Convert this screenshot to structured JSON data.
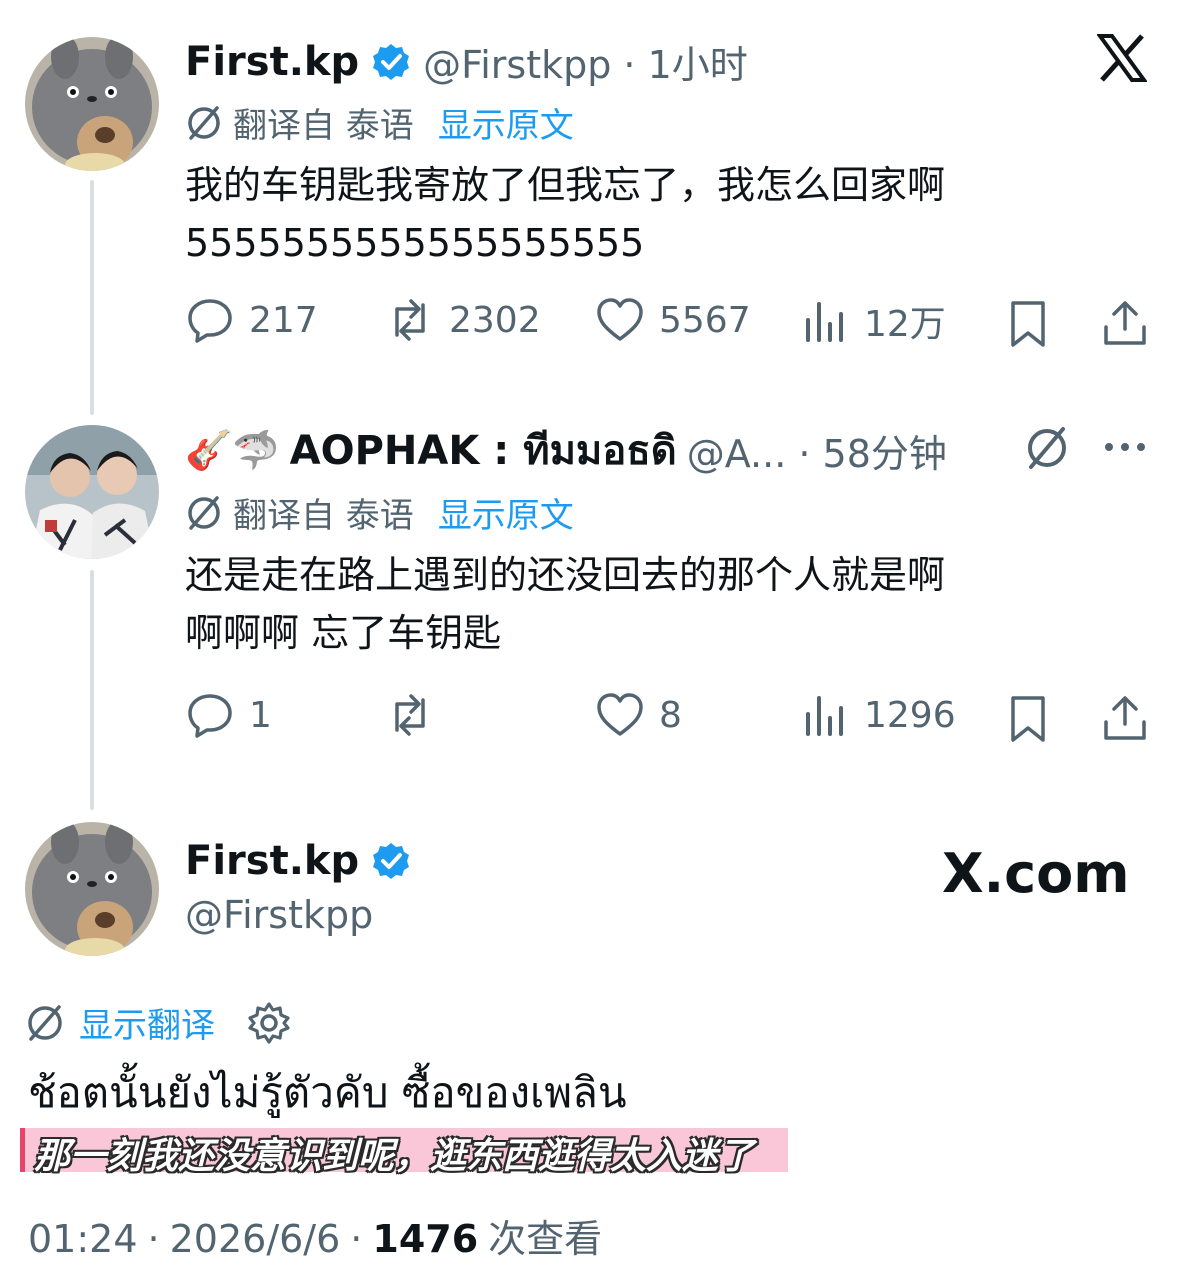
{
  "tweet1": {
    "name": "First.kp",
    "handle_time": "@Firstkpp · 1小时",
    "translated_from": "翻译自 泰语",
    "show_original": "显示原文",
    "text_line1": "我的车钥匙我寄放了但我忘了，我怎么回家啊",
    "text_line2": "5555555555555555555",
    "replies": "217",
    "retweets": "2302",
    "likes": "5567",
    "views": "12万"
  },
  "tweet2": {
    "emoji": "🎸🦈",
    "name": "AOPHAK : ทีมมอธดิ",
    "handle_time": "@A... · 58分钟",
    "translated_from": "翻译自 泰语",
    "show_original": "显示原文",
    "text_line1": "还是走在路上遇到的还没回去的那个人就是啊",
    "text_line2": "啊啊啊 忘了车钥匙",
    "replies": "1",
    "retweets": "",
    "likes": "8",
    "views": "1296"
  },
  "tweet3": {
    "name": "First.kp",
    "handle": "@Firstkpp",
    "watermark": "X.com",
    "show_translation": "显示翻译",
    "text": "ช้อตนั้นยังไม่รู้ตัวคับ ซื้อของเพลิน",
    "subtitle": "那一刻我还没意识到呢，逛东西逛得太入迷了",
    "time": "01:24",
    "date": "2026/6/6",
    "views_count": "1476",
    "views_label": "次查看"
  },
  "colors": {
    "text": "#0f1419",
    "secondary": "#536471",
    "link": "#1d9bf0",
    "verified": "#1d9bf0",
    "subtitle_bg": "#f9c7d8"
  }
}
